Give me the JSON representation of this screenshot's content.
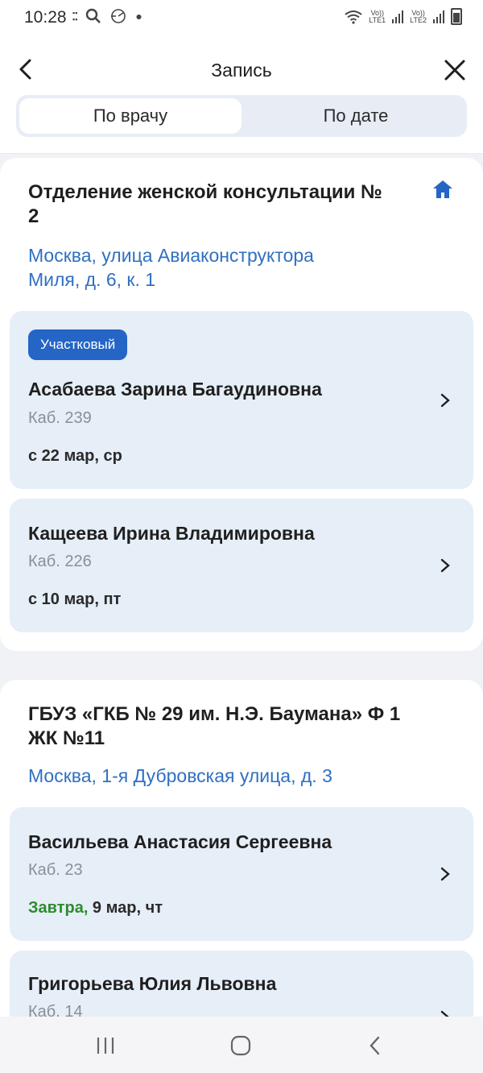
{
  "statusbar": {
    "time": "10:28",
    "icons": [
      "dm-icon",
      "search-icon",
      "radar-icon",
      "dot-icon"
    ],
    "lte1": "LTE1",
    "lte2": "LTE2",
    "volte": "Vo))"
  },
  "header": {
    "title": "Запись"
  },
  "segment": {
    "by_doctor": "По врачу",
    "by_date": "По дате"
  },
  "clinics": [
    {
      "name_line1": "Отделение женской консультации №",
      "name_line2": "2",
      "addr_line1": "Москва, улица Авиаконструктора",
      "addr_line2": "Миля, д. 6, к. 1",
      "doctors": [
        {
          "badge": "Участковый",
          "name": "Асабаева Зарина Багаудиновна",
          "room": "Каб. 239",
          "date_prefix": "",
          "date": "с 22 мар, ср"
        },
        {
          "name": "Кащеева Ирина Владимировна",
          "room": "Каб. 226",
          "date_prefix": "",
          "date": "с 10 мар, пт"
        }
      ]
    },
    {
      "name_line1": "ГБУЗ «ГКБ № 29 им. Н.Э. Баумана» Ф 1",
      "name_line2": "ЖК №11",
      "addr_line1": "Москва, 1-я Дубровская улица, д. 3",
      "doctors": [
        {
          "name": "Васильева Анастасия Сергеевна",
          "room": "Каб. 23",
          "date_prefix": "Завтра,",
          "date": " 9 мар, чт"
        },
        {
          "name": "Григорьева Юлия Львовна",
          "room": "Каб. 14"
        }
      ]
    }
  ],
  "colors": {
    "accent": "#2465c6",
    "link": "#2f70c2",
    "card_bg": "#e6eef8",
    "green": "#2e8b2e"
  }
}
